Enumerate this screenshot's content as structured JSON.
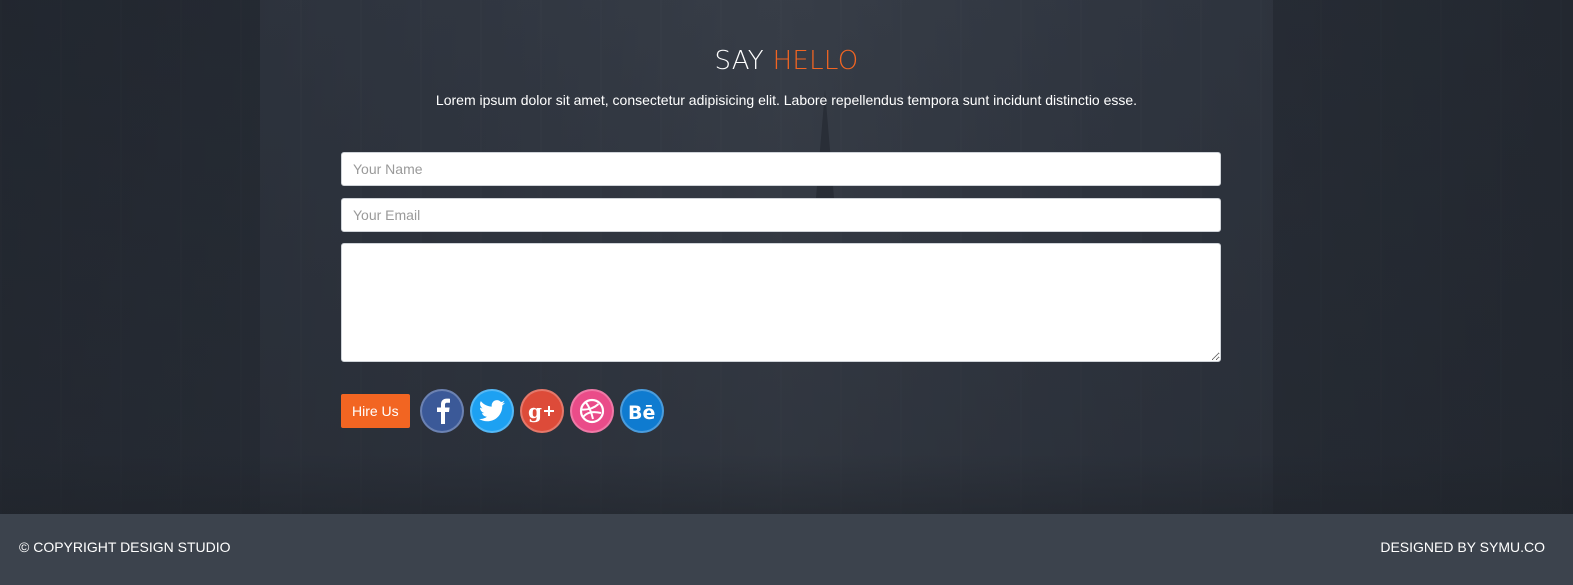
{
  "contact": {
    "heading_prefix": "SAY",
    "heading_accent": "HELLO",
    "subtitle": "Lorem ipsum dolor sit amet, consectetur adipisicing elit. Labore repellendus tempora sunt incidunt distinctio esse.",
    "name_placeholder": "Your Name",
    "email_placeholder": "Your Email",
    "message_placeholder": "",
    "hire_button": "Hire Us"
  },
  "social": [
    {
      "name": "facebook-icon",
      "color": "#3b5998"
    },
    {
      "name": "twitter-icon",
      "color": "#1da1f2"
    },
    {
      "name": "google-plus-icon",
      "color": "#dd4b39"
    },
    {
      "name": "dribbble-icon",
      "color": "#ea4c89"
    },
    {
      "name": "behance-icon",
      "color": "#0f7bd0"
    }
  ],
  "footer": {
    "copyright": "© COPYRIGHT DESIGN STUDIO",
    "designed_by": "DESIGNED BY SYMU.CO"
  },
  "colors": {
    "accent": "#f26522",
    "footer_bg": "#3c434d"
  }
}
